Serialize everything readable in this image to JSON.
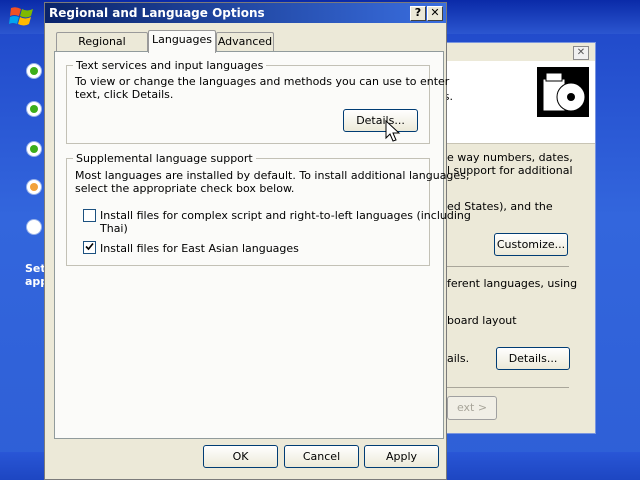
{
  "dialog": {
    "title": "Regional and Language Options",
    "help_glyph": "?",
    "close_glyph": "✕",
    "tabs": [
      {
        "label": "Regional Options",
        "active": false
      },
      {
        "label": "Languages",
        "active": true
      },
      {
        "label": "Advanced",
        "active": false
      }
    ],
    "text_services": {
      "group_label": "Text services and input languages",
      "line1": "To view or change the languages and methods you can use to enter",
      "line2": "text, click Details.",
      "details_button": "Details..."
    },
    "supplemental": {
      "group_label": "Supplemental language support",
      "line1": "Most languages are installed by default. To install additional languages,",
      "line2": "select the appropriate check box below.",
      "complex_script": {
        "label_line1": "Install files for complex script and right-to-left languages (including",
        "label_line2": "Thai)",
        "checked": false
      },
      "east_asian": {
        "label": "Install files for East Asian languages",
        "checked": true
      }
    },
    "buttons": {
      "ok": "OK",
      "cancel": "Cancel",
      "apply": "Apply"
    }
  },
  "behind_window": {
    "close_glyph": "✕",
    "header_text": "es.",
    "text_lines": [
      "e way numbers, dates,",
      "l support for additional",
      "ed States), and the",
      "ferent languages, using",
      "board layout",
      "ails."
    ],
    "customize_button": "Customize...",
    "details_button": "Details...",
    "next_button": "ext >"
  },
  "desktop": {
    "setup_steps": [
      "done",
      "done",
      "done",
      "current",
      "pending"
    ],
    "side_text_line1": "Set",
    "side_text_line2": "app"
  }
}
